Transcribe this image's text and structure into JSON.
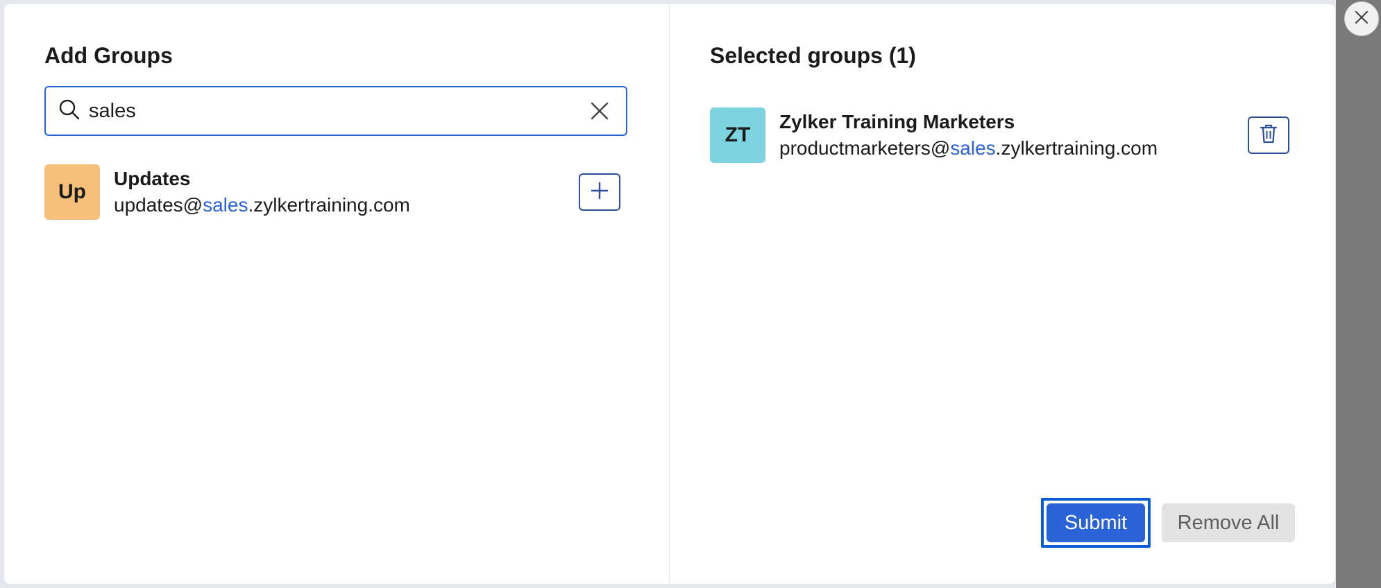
{
  "left_pane": {
    "title": "Add Groups",
    "search": {
      "value": "sales",
      "placeholder": ""
    },
    "results": [
      {
        "initials": "Up",
        "avatar_color": "#f6c07a",
        "name": "Updates",
        "email_prefix": "updates@",
        "email_highlight": "sales",
        "email_suffix": ".zylkertraining.com"
      }
    ]
  },
  "right_pane": {
    "title": "Selected groups (1)",
    "selected": [
      {
        "initials": "ZT",
        "avatar_color": "#7dd3df",
        "name": "Zylker Training Marketers",
        "email_prefix": "productmarketers@",
        "email_highlight": "sales",
        "email_suffix": ".zylkertraining.com"
      }
    ]
  },
  "footer": {
    "submit_label": "Submit",
    "remove_all_label": "Remove All"
  },
  "colors": {
    "accent": "#2a62d8",
    "focus_ring": "#0b5ad6"
  }
}
